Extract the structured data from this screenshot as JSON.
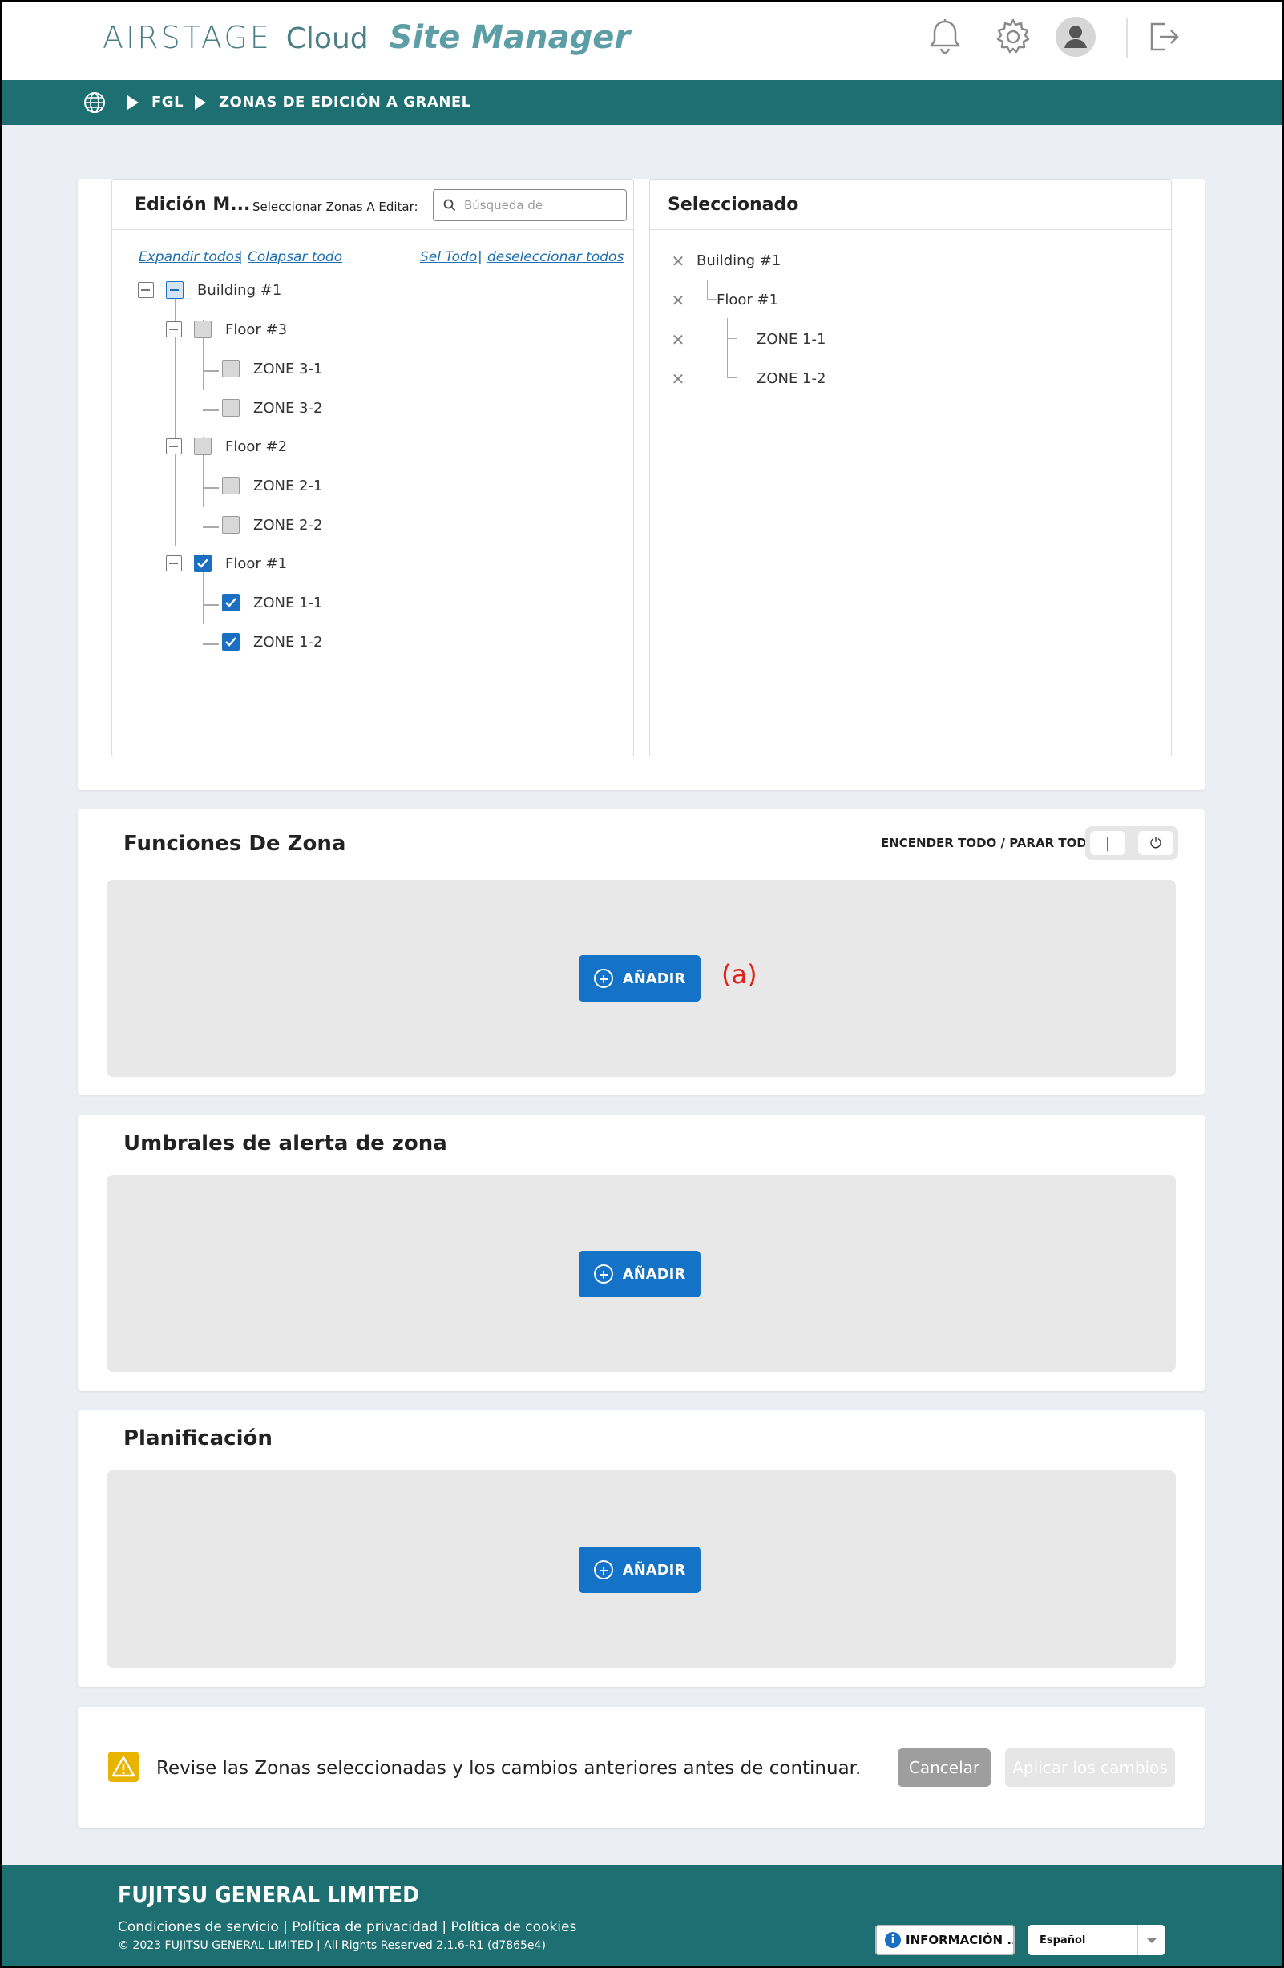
{
  "header": {
    "brand_airstage": "AIRSTAGE",
    "brand_cloud": "Cloud",
    "brand_site": "Site Manager"
  },
  "breadcrumb": {
    "items": [
      "FGL",
      "ZONAS DE EDICIÓN A GRANEL"
    ]
  },
  "edit_panel": {
    "title": "Edición M...",
    "search_label": "Seleccionar Zonas A Editar:",
    "search_placeholder": "Búsqueda de",
    "expand_all": "Expandir todos",
    "collapse_all": "Colapsar todo",
    "select_all": "Sel Todo",
    "deselect_all": "deseleccionar todos",
    "separator": "|",
    "tree": [
      {
        "label": "Building #1",
        "state": "indeterminate"
      },
      {
        "label": "Floor #3",
        "state": "unchecked"
      },
      {
        "label": "ZONE 3-1",
        "state": "unchecked"
      },
      {
        "label": "ZONE 3-2",
        "state": "unchecked"
      },
      {
        "label": "Floor #2",
        "state": "unchecked"
      },
      {
        "label": "ZONE 2-1",
        "state": "unchecked"
      },
      {
        "label": "ZONE 2-2",
        "state": "unchecked"
      },
      {
        "label": "Floor #1",
        "state": "checked"
      },
      {
        "label": "ZONE 1-1",
        "state": "checked"
      },
      {
        "label": "ZONE 1-2",
        "state": "checked"
      }
    ]
  },
  "selected_panel": {
    "title": "Seleccionado",
    "remove_glyph": "✕",
    "items": [
      "Building #1",
      "Floor #1",
      "ZONE 1-1",
      "ZONE 1-2"
    ]
  },
  "zone_functions": {
    "title": "Funciones De Zona",
    "on_off_label": "ENCENDER TODO / PARAR TODO:",
    "on_glyph": "|",
    "off_glyph": "⏻",
    "add_label": "AÑADIR",
    "annotation": "(a)"
  },
  "alert_thresholds": {
    "title": "Umbrales de alerta de zona",
    "add_label": "AÑADIR"
  },
  "scheduling": {
    "title": "Planificación",
    "add_label": "AÑADIR"
  },
  "confirm": {
    "message": "Revise las Zonas seleccionadas y los cambios anteriores antes de continuar.",
    "cancel": "Cancelar",
    "apply": "Aplicar los cambios"
  },
  "footer": {
    "company": "FUJITSU GENERAL LIMITED",
    "links": "Condiciones de servicio | Política de privacidad | Política de cookies",
    "copyright": "© 2023 FUJITSU GENERAL LIMITED | All Rights Reserved 2.1.6-R1 (d7865e4)",
    "info_button": "INFORMACIÓN ...",
    "info_glyph": "i",
    "language": "Español"
  },
  "colors": {
    "teal": "#1d6f71",
    "primary_blue": "#1473c6",
    "warning": "#e8b400",
    "annotation_red": "#e0211b"
  }
}
